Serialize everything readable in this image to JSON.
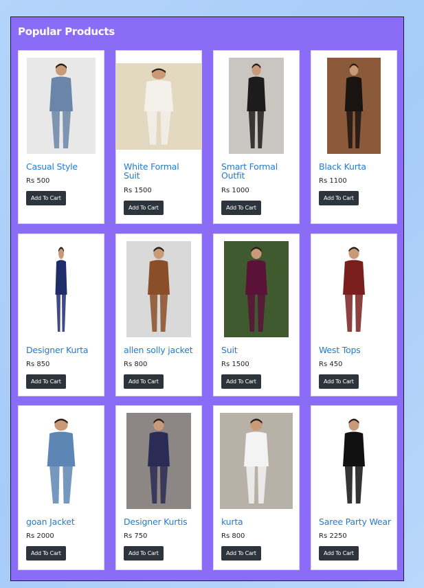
{
  "section_title": "Popular Products",
  "button_label": "Add To Cart",
  "products": [
    {
      "name": "Casual Style",
      "price": "Rs 500",
      "image": "man-denim-jacket-photo",
      "bg": "#e8e8e8",
      "fg": "#6b86a8"
    },
    {
      "name": "White Formal Suit",
      "price": "Rs 1500",
      "image": "woman-white-suit-photo",
      "bg": "#e3d8c0",
      "fg": "#f4f1ea"
    },
    {
      "name": "Smart Formal Outfit",
      "price": "Rs 1000",
      "image": "man-black-shirt-grey-pants-photo",
      "bg": "#c9c6c2",
      "fg": "#1c1c1c"
    },
    {
      "name": "Black Kurta",
      "price": "Rs 1100",
      "image": "boy-black-kurta-photo",
      "bg": "#8a5a3a",
      "fg": "#1a1410"
    },
    {
      "name": "Designer Kurta",
      "price": "Rs 850",
      "image": "man-navy-kurta-photo",
      "bg": "#ffffff",
      "fg": "#1f2d6b"
    },
    {
      "name": "allen solly jacket",
      "price": "Rs 800",
      "image": "woman-brown-leather-jacket-photo",
      "bg": "#d9d9d9",
      "fg": "#8a4e28"
    },
    {
      "name": "Suit",
      "price": "Rs 1500",
      "image": "woman-maroon-suit-photo",
      "bg": "#3e5a2e",
      "fg": "#5a1238"
    },
    {
      "name": "West Tops",
      "price": "Rs 450",
      "image": "woman-maroon-top-photo",
      "bg": "#ffffff",
      "fg": "#7a1e1e"
    },
    {
      "name": "goan Jacket",
      "price": "Rs 2000",
      "image": "kids-denim-jacket-photo",
      "bg": "#ffffff",
      "fg": "#5e86b4"
    },
    {
      "name": "Designer Kurtis",
      "price": "Rs 750",
      "image": "woman-navy-kurti-photo",
      "bg": "#8c8784",
      "fg": "#2b2c55"
    },
    {
      "name": "kurta",
      "price": "Rs 800",
      "image": "woman-white-suit-outdoor-photo",
      "bg": "#b8b1a8",
      "fg": "#f3f3f3"
    },
    {
      "name": "Saree Party Wear",
      "price": "Rs 2250",
      "image": "woman-black-gold-saree-photo",
      "bg": "#ffffff",
      "fg": "#111111"
    }
  ]
}
